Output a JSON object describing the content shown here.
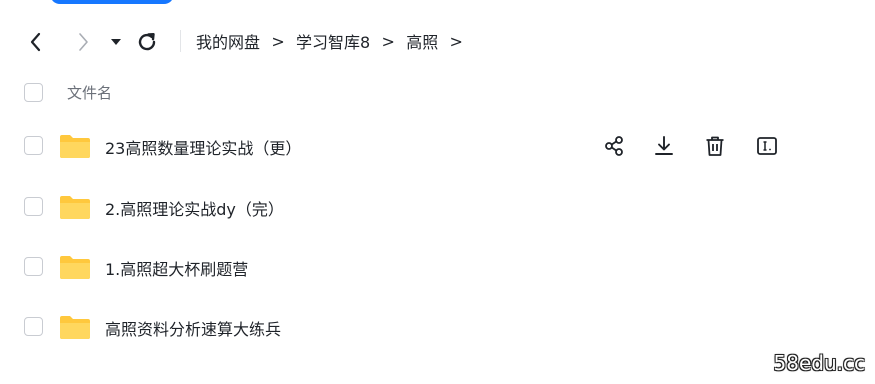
{
  "toolbar": {
    "back_icon": "chevron-left-icon",
    "forward_icon": "chevron-right-icon",
    "dropdown_icon": "caret-down-icon",
    "refresh_icon": "refresh-icon"
  },
  "breadcrumb": {
    "separator": ">",
    "items": [
      "我的网盘",
      "学习智库8",
      "高照"
    ]
  },
  "list": {
    "column_name": "文件名",
    "folder_color": "#ffc83d",
    "files": [
      {
        "name": "23高照数量理论实战（更）",
        "hovered": true
      },
      {
        "name": "2.高照理论实战dy（完）",
        "hovered": false
      },
      {
        "name": "1.高照超大杯刷题营",
        "hovered": false
      },
      {
        "name": "高照资料分析速算大练兵",
        "hovered": false
      }
    ],
    "row_actions": [
      "share-icon",
      "download-icon",
      "delete-icon",
      "rename-icon"
    ]
  },
  "watermark": "58edu.cc",
  "colors": {
    "accent": "#1677ff",
    "text": "#1f2329",
    "muted": "#6b7079"
  }
}
